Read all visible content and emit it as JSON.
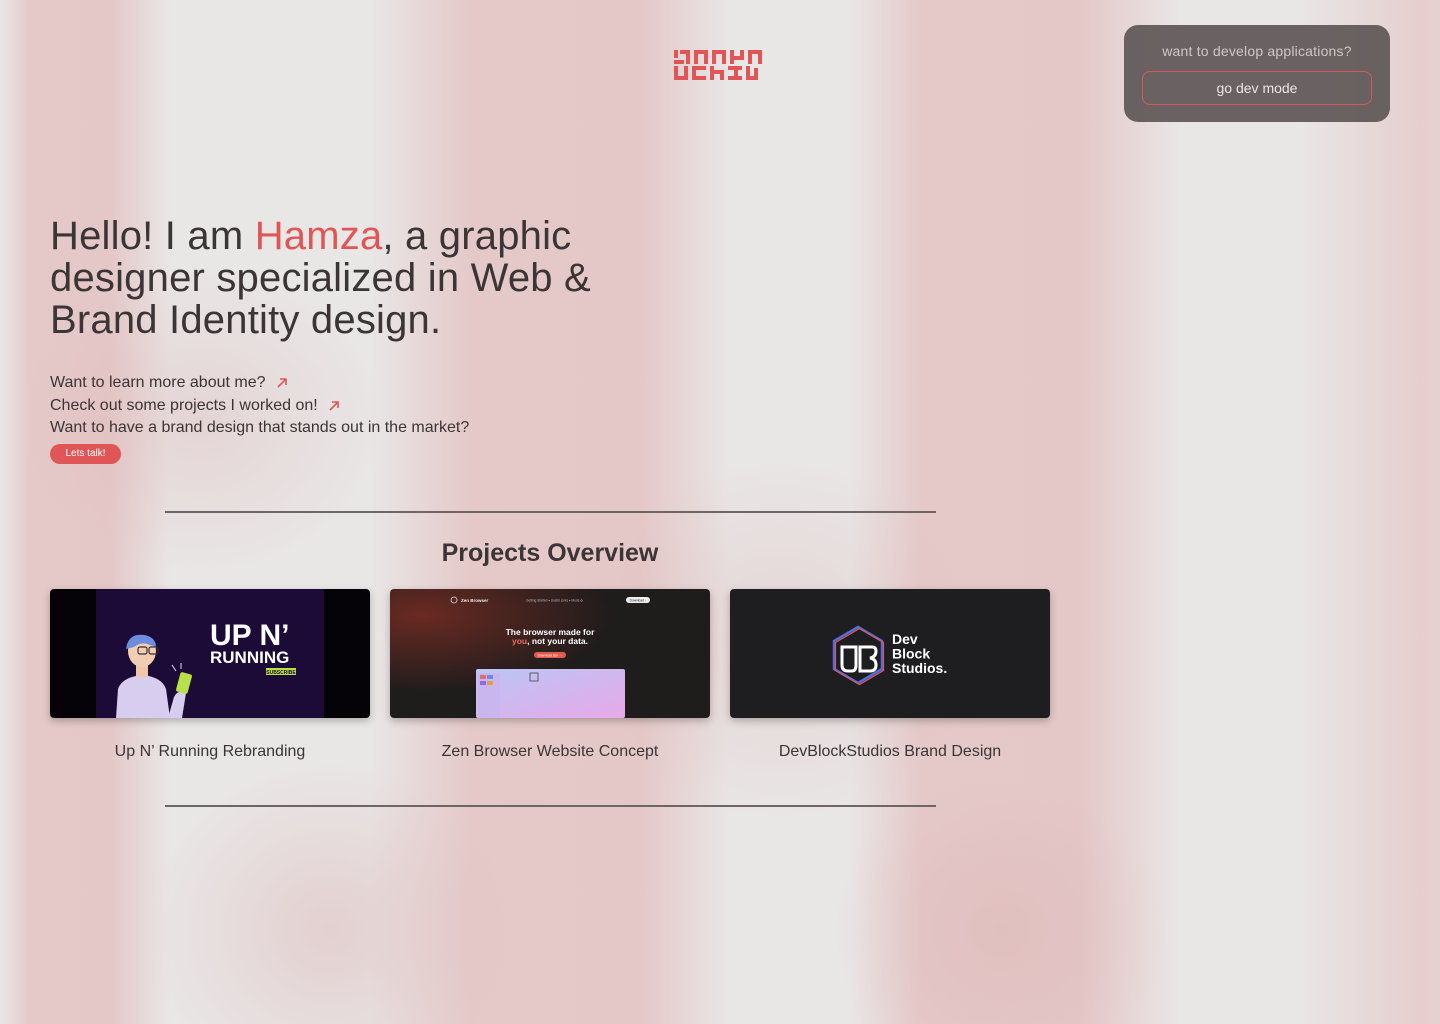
{
  "brand": {
    "logo_icon": "hamza-arabic-logotype",
    "accent_color": "#e05656"
  },
  "dev_mode": {
    "prompt": "want to develop applications?",
    "button_label": "go dev mode"
  },
  "hero": {
    "line_prefix": "Hello! I am ",
    "name": "Hamza",
    "line_suffix": ", a graphic designer specialized in Web & Brand Identity design."
  },
  "links": [
    {
      "label": "Want to learn more about me?",
      "icon": "arrow-up-right-icon"
    },
    {
      "label": "Check out some projects I worked on!",
      "icon": "arrow-up-right-icon"
    },
    {
      "label": "Want to have a brand design that stands out in the market?"
    }
  ],
  "cta": {
    "label": "Lets talk!"
  },
  "projects": {
    "title": "Projects Overview",
    "items": [
      {
        "label": "Up N’ Running Rebranding",
        "thumb": {
          "title_line1": "UP N’",
          "title_line2": "RUNNING",
          "badge": "SUBSCRIBE"
        }
      },
      {
        "label": "Zen Browser Website Concept",
        "thumb": {
          "nav_brand": "Zen Browser",
          "nav_links": "Getting Started ▾   Useful Links ▾   Mods ✿",
          "nav_button": "Download ↓",
          "headline_line1": "The browser made for",
          "headline_accent": "you",
          "headline_line2_rest": ", not your data.",
          "cta": "Download Zen →"
        }
      },
      {
        "label": "DevBlockStudios Brand Design",
        "thumb": {
          "line1": "Dev",
          "line2": "Block",
          "line3": "Studios."
        }
      }
    ]
  }
}
